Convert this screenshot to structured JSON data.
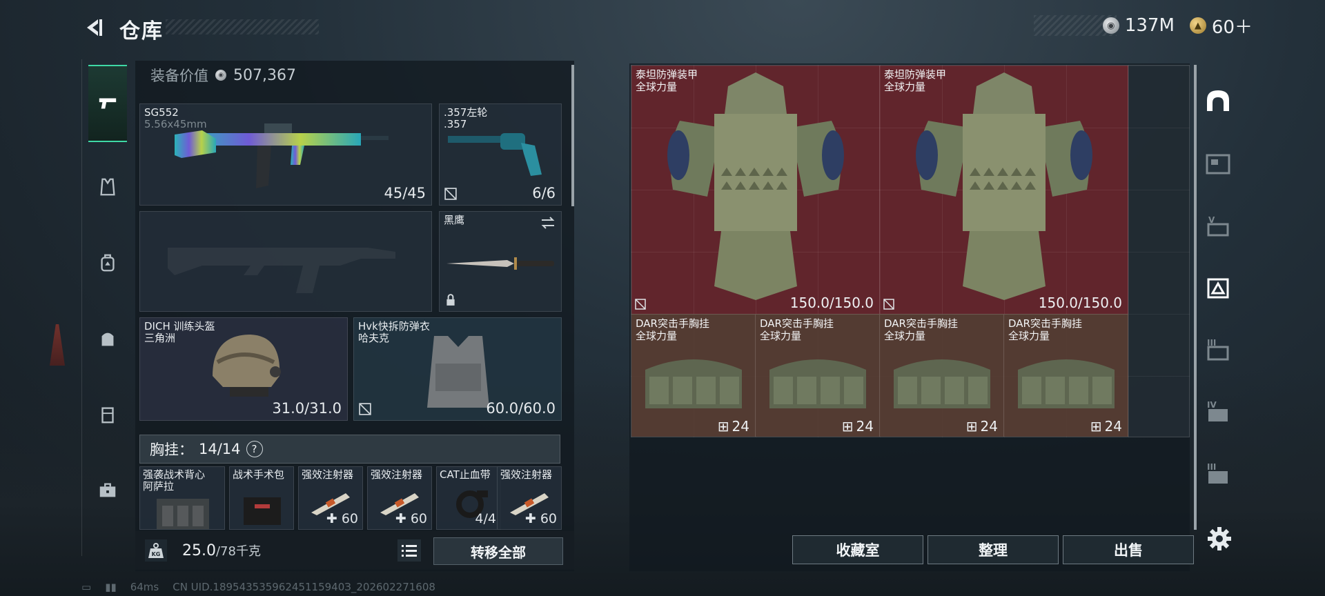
{
  "header": {
    "title": "仓库"
  },
  "currency": [
    {
      "icon": "silver-coin-icon",
      "value": "137M"
    },
    {
      "icon": "gold-coin-icon",
      "value": "60＋"
    }
  ],
  "loadout": {
    "equip_value_label": "装备价值",
    "equip_value": "507,367",
    "primary": {
      "name": "SG552",
      "caliber": "5.56x45mm",
      "durability": "45/45"
    },
    "sidearm": {
      "name": ".357左轮",
      "caliber": ".357",
      "durability": "6/6"
    },
    "melee": {
      "name": "黑鹰"
    },
    "helmet": {
      "name": "DICH 训练头盔",
      "brand": "三角洲",
      "durability": "31.0/31.0"
    },
    "armor": {
      "name": "Hvk快拆防弹衣",
      "brand": "哈夫克",
      "durability": "60.0/60.0"
    },
    "chest_rig": {
      "label": "胸挂：",
      "capacity": "14/14",
      "help": "?"
    },
    "rig_slots": [
      {
        "name": "强袭战术背心",
        "brand": "阿萨拉",
        "count": ""
      },
      {
        "name": "战术手术包",
        "brand": "",
        "count": ""
      },
      {
        "name": "强效注射器",
        "brand": "",
        "count": "60"
      },
      {
        "name": "强效注射器",
        "brand": "",
        "count": "60"
      },
      {
        "name": "CAT止血带",
        "brand": "",
        "count": "4/4"
      },
      {
        "name": "强效注射器",
        "brand": "",
        "count": "60"
      }
    ],
    "weight": {
      "current": "25.0",
      "max": "/78千克"
    },
    "transfer_all": "转移全部"
  },
  "storage": {
    "armors": [
      {
        "name": "泰坦防弹装甲",
        "brand": "全球力量",
        "durability": "150.0/150.0"
      },
      {
        "name": "泰坦防弹装甲",
        "brand": "全球力量",
        "durability": "150.0/150.0"
      }
    ],
    "rigs": [
      {
        "name": "DAR突击手胸挂",
        "brand": "全球力量",
        "slots": "24"
      },
      {
        "name": "DAR突击手胸挂",
        "brand": "全球力量",
        "slots": "24"
      },
      {
        "name": "DAR突击手胸挂",
        "brand": "全球力量",
        "slots": "24"
      },
      {
        "name": "DAR突击手胸挂",
        "brand": "全球力量",
        "slots": "24"
      }
    ],
    "buttons": {
      "collection": "收藏室",
      "organize": "整理",
      "sell": "出售"
    }
  },
  "status": {
    "ping": "64ms",
    "uid": "CN UID.18954353596245115940З_202602271608"
  },
  "colors": {
    "accent": "#3fd9a6",
    "armor_bg": "#6c242c",
    "rig_bg": "#5c3e32"
  }
}
